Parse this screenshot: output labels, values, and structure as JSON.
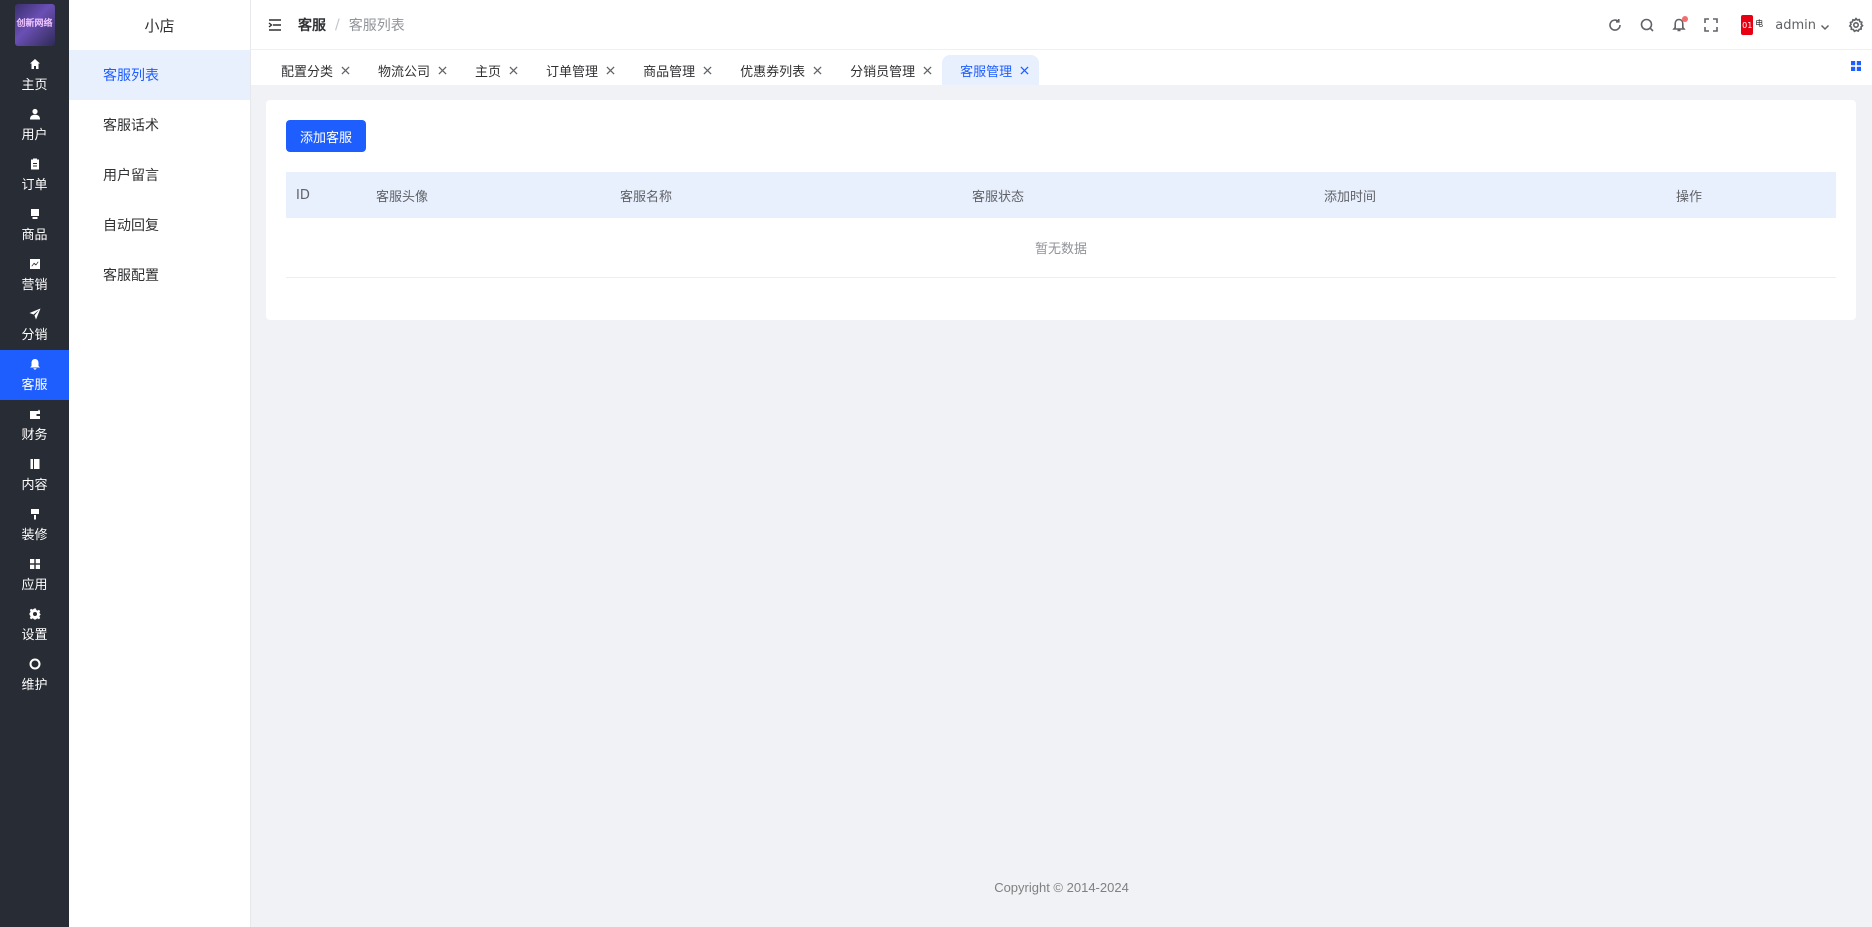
{
  "brand": {
    "logo_text": "创新网络"
  },
  "rail": {
    "items": [
      {
        "label": "主页",
        "icon": "home-icon",
        "active": false
      },
      {
        "label": "用户",
        "icon": "user-icon",
        "active": false
      },
      {
        "label": "订单",
        "icon": "clipboard-icon",
        "active": false
      },
      {
        "label": "商品",
        "icon": "goods-icon",
        "active": false
      },
      {
        "label": "营销",
        "icon": "chart-icon",
        "active": false
      },
      {
        "label": "分销",
        "icon": "send-icon",
        "active": false
      },
      {
        "label": "客服",
        "icon": "bell-icon",
        "active": true
      },
      {
        "label": "财务",
        "icon": "wallet-icon",
        "active": false
      },
      {
        "label": "内容",
        "icon": "book-icon",
        "active": false
      },
      {
        "label": "装修",
        "icon": "brush-icon",
        "active": false
      },
      {
        "label": "应用",
        "icon": "apps-icon",
        "active": false
      },
      {
        "label": "设置",
        "icon": "gear-icon",
        "active": false
      },
      {
        "label": "维护",
        "icon": "maintenance-icon",
        "active": false
      }
    ]
  },
  "submenu": {
    "title": "小店",
    "items": [
      {
        "label": "客服列表",
        "active": true
      },
      {
        "label": "客服话术",
        "active": false
      },
      {
        "label": "用户留言",
        "active": false
      },
      {
        "label": "自动回复",
        "active": false
      },
      {
        "label": "客服配置",
        "active": false
      }
    ]
  },
  "header": {
    "breadcrumb_parent": "客服",
    "breadcrumb_separator": "/",
    "breadcrumb_current": "客服列表",
    "user_name": "admin",
    "avatar_text_1": "01",
    "avatar_text_2": "电"
  },
  "tabs": [
    {
      "label": "配置分类",
      "active": false
    },
    {
      "label": "物流公司",
      "active": false
    },
    {
      "label": "主页",
      "active": false
    },
    {
      "label": "订单管理",
      "active": false
    },
    {
      "label": "商品管理",
      "active": false
    },
    {
      "label": "优惠券列表",
      "active": false
    },
    {
      "label": "分销员管理",
      "active": false
    },
    {
      "label": "客服管理",
      "active": true
    }
  ],
  "main": {
    "add_button": "添加客服",
    "columns": [
      "ID",
      "客服头像",
      "客服名称",
      "客服状态",
      "添加时间",
      "操作"
    ],
    "empty_text": "暂无数据"
  },
  "footer": {
    "copyright": "Copyright © 2014-2024"
  },
  "colors": {
    "primary": "#1e5eff",
    "rail_bg": "#282c34",
    "active_bg": "#e8f0fe"
  }
}
